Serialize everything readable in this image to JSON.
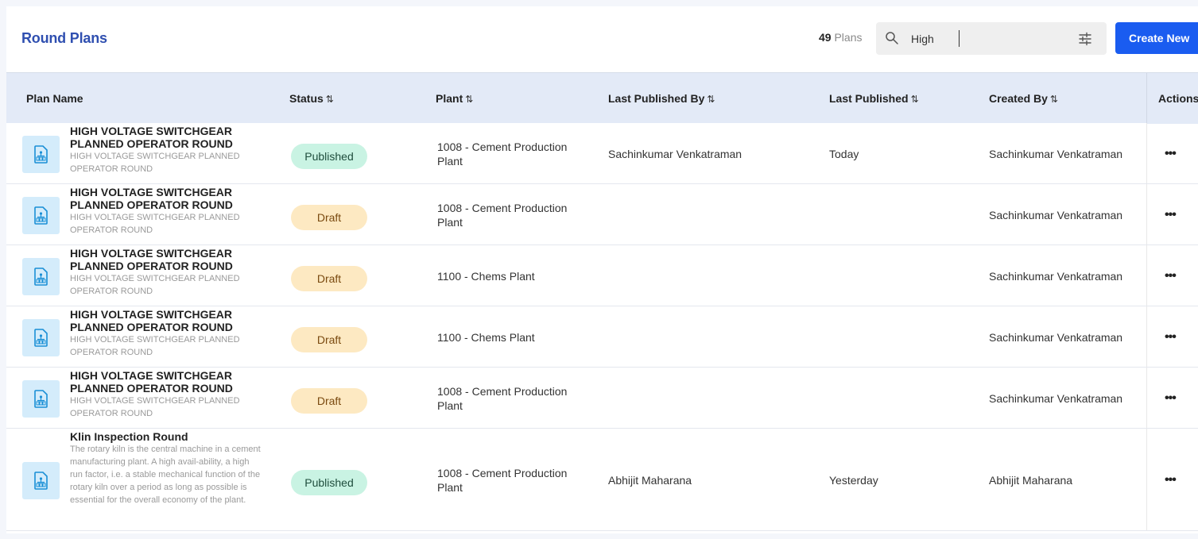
{
  "header": {
    "title": "Round Plans",
    "count_number": "49",
    "count_label": "Plans",
    "search_value": "High",
    "create_label": "Create New"
  },
  "table": {
    "columns": [
      {
        "label": "Plan Name",
        "sortable": false
      },
      {
        "label": "Status",
        "sortable": true
      },
      {
        "label": "Plant",
        "sortable": true
      },
      {
        "label": "Last Published By",
        "sortable": true
      },
      {
        "label": "Last Published",
        "sortable": true
      },
      {
        "label": "Created By",
        "sortable": true
      },
      {
        "label": "Actions",
        "sortable": false
      }
    ],
    "sort_glyph": "⇅",
    "actions_glyph": "•••",
    "rows": [
      {
        "name": "HIGH VOLTAGE SWITCHGEAR PLANNED OPERATOR ROUND",
        "description": "HIGH VOLTAGE SWITCHGEAR PLANNED OPERATOR ROUND",
        "status": "Published",
        "plant": "1008 - Cement Production Plant",
        "last_published_by": "Sachinkumar Venkatraman",
        "last_published": "Today",
        "created_by": "Sachinkumar Venkatraman"
      },
      {
        "name": "HIGH VOLTAGE SWITCHGEAR PLANNED OPERATOR ROUND",
        "description": "HIGH VOLTAGE SWITCHGEAR PLANNED OPERATOR ROUND",
        "status": "Draft",
        "plant": "1008 - Cement Production Plant",
        "last_published_by": "",
        "last_published": "",
        "created_by": "Sachinkumar Venkatraman"
      },
      {
        "name": "HIGH VOLTAGE SWITCHGEAR PLANNED OPERATOR ROUND",
        "description": "HIGH VOLTAGE SWITCHGEAR PLANNED OPERATOR ROUND",
        "status": "Draft",
        "plant": "1100 - Chems Plant",
        "last_published_by": "",
        "last_published": "",
        "created_by": "Sachinkumar Venkatraman"
      },
      {
        "name": "HIGH VOLTAGE SWITCHGEAR PLANNED OPERATOR ROUND",
        "description": "HIGH VOLTAGE SWITCHGEAR PLANNED OPERATOR ROUND",
        "status": "Draft",
        "plant": "1100 - Chems Plant",
        "last_published_by": "",
        "last_published": "",
        "created_by": "Sachinkumar Venkatraman"
      },
      {
        "name": "HIGH VOLTAGE SWITCHGEAR PLANNED OPERATOR ROUND",
        "description": "HIGH VOLTAGE SWITCHGEAR PLANNED OPERATOR ROUND",
        "status": "Draft",
        "plant": "1008 - Cement Production Plant",
        "last_published_by": "",
        "last_published": "",
        "created_by": "Sachinkumar Venkatraman"
      },
      {
        "name": "Klin Inspection Round",
        "description": "The rotary kiln is the central machine in a cement manufacturing plant. A high avail-ability, a high run factor, i.e. a stable mechanical function of the rotary kiln over a period as long as possible is essential for the overall economy of the plant.",
        "status": "Published",
        "plant": "1008 - Cement Production Plant",
        "last_published_by": "Abhijit Maharana",
        "last_published": "Yesterday",
        "created_by": "Abhijit Maharana"
      }
    ]
  },
  "colors": {
    "title": "#2f4fb0",
    "create_button": "#1a5cf0",
    "header_row": "#e3eaf7",
    "published_badge": "#c9f3e3",
    "draft_badge": "#fde9c2",
    "thumb_bg": "#d4ecfb"
  },
  "icons": {
    "search": "search-icon",
    "filter": "filter-sliders-icon",
    "plan": "document-diagram-icon"
  }
}
